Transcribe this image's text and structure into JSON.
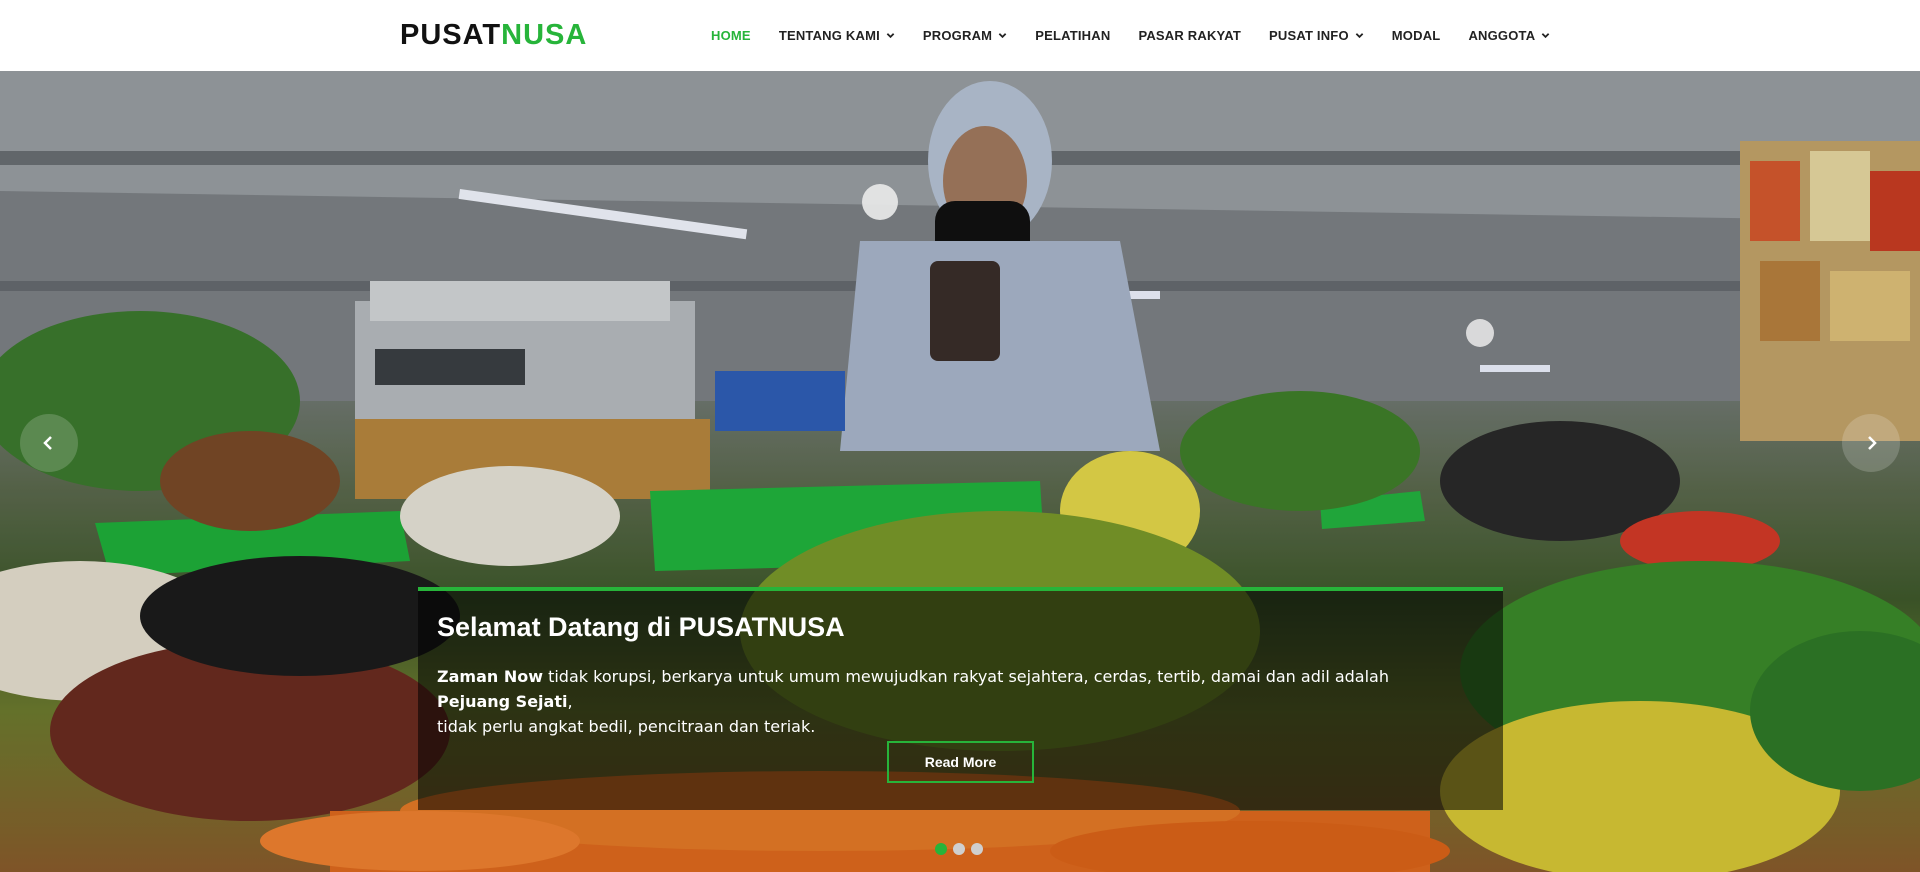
{
  "brand": {
    "part1": "PUSAT",
    "part2": "NUSA"
  },
  "nav": {
    "items": [
      {
        "label": "HOME",
        "has_dropdown": false,
        "active": true
      },
      {
        "label": "TENTANG KAMI",
        "has_dropdown": true,
        "active": false
      },
      {
        "label": "PROGRAM",
        "has_dropdown": true,
        "active": false
      },
      {
        "label": "PELATIHAN",
        "has_dropdown": false,
        "active": false
      },
      {
        "label": "PASAR RAKYAT",
        "has_dropdown": false,
        "active": false
      },
      {
        "label": "PUSAT INFO",
        "has_dropdown": true,
        "active": false
      },
      {
        "label": "MODAL",
        "has_dropdown": false,
        "active": false
      },
      {
        "label": "ANGGOTA",
        "has_dropdown": true,
        "active": false
      }
    ],
    "dropdown_icon": "chevron-down-icon"
  },
  "hero": {
    "image_subject": "market-vendor-photo",
    "caption": {
      "title": "Selamat Datang di PUSATNUSA",
      "text_bold_1": "Zaman Now",
      "text_1": " tidak korupsi, berkarya untuk umum mewujudkan rakyat sejahtera, cerdas, tertib, damai dan adil adalah ",
      "text_bold_2": "Pejuang Sejati",
      "text_2": ",",
      "text_3": "tidak perlu angkat bedil, pencitraan dan teriak.",
      "button_label": "Read More"
    },
    "slider": {
      "prev_icon": "chevron-left-icon",
      "next_icon": "chevron-right-icon",
      "slide_count": 3,
      "active_slide": 1
    }
  },
  "colors": {
    "accent": "#27b43a",
    "nav_text": "#222222",
    "caption_bg": "rgba(0,0,0,0.55)"
  }
}
